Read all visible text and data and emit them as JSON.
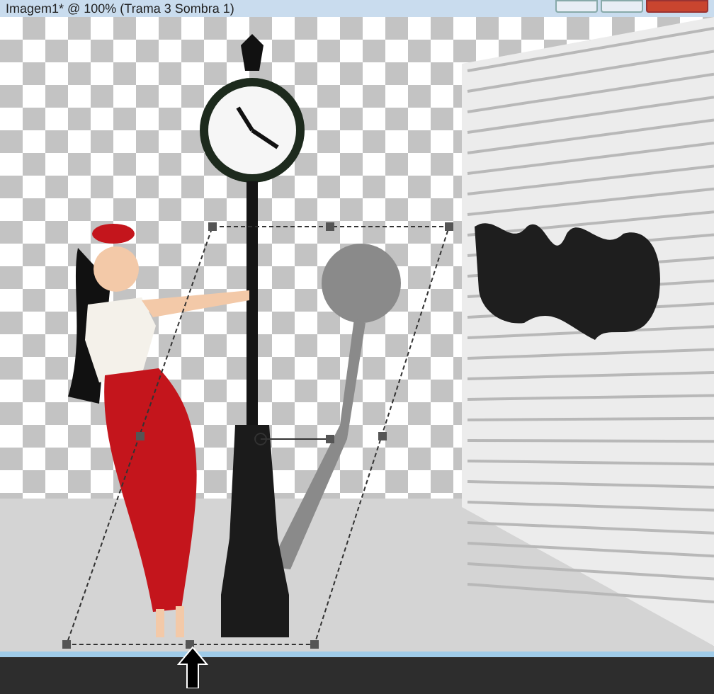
{
  "window": {
    "title": "Imagem1* @ 100% (Trama 3 Sombra 1)"
  }
}
